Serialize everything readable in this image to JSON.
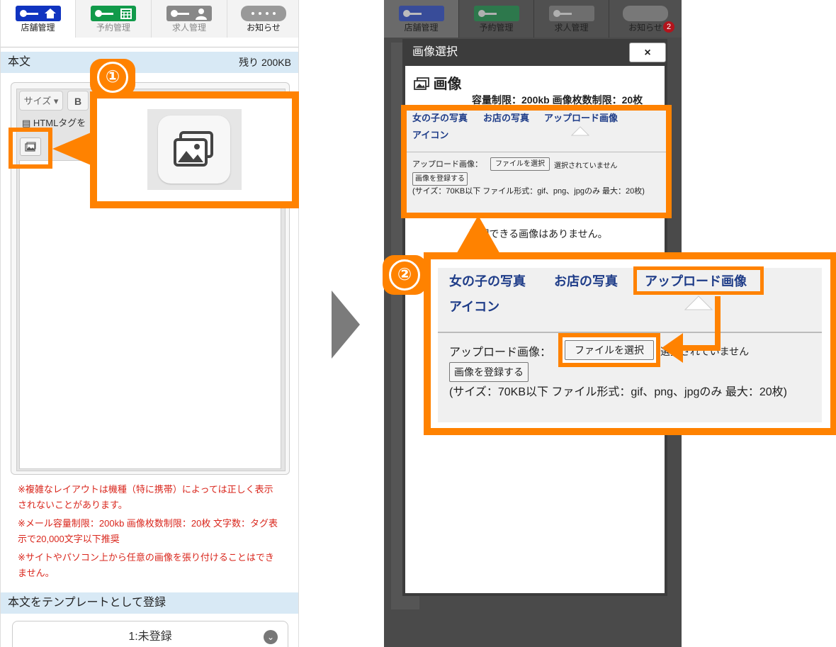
{
  "left": {
    "tabs": [
      {
        "label": "店舗管理",
        "icon": "store-key-icon",
        "color": "#1034c0"
      },
      {
        "label": "予約管理",
        "icon": "calendar-key-icon",
        "color": "#119a4a"
      },
      {
        "label": "求人管理",
        "icon": "person-key-icon",
        "color": "#888888"
      },
      {
        "label": "お知らせ",
        "icon": "speech-bubble-icon",
        "color": "#888888"
      }
    ],
    "body_section": {
      "title": "本文",
      "remaining": "残り 200KB"
    },
    "editor": {
      "size_label": "サイズ",
      "bold_label": "B",
      "html_tag_label": "HTMLタグを"
    },
    "notes": [
      "※複雑なレイアウトは機種（特に携帯）によっては正しく表示されないことがあります。",
      "※メール容量制限：200kb 画像枚数制限：20枚 文字数：タグ表示で20,000文字以下推奨",
      "※サイトやパソコン上から任意の画像を張り付けることはできません。"
    ],
    "template_section": {
      "title": "本文をテンプレートとして登録"
    },
    "template_select": {
      "value": "1:未登録"
    }
  },
  "callout1": {
    "number": "①"
  },
  "right": {
    "tabs": [
      {
        "label": "店舗管理",
        "color": "#1034c0"
      },
      {
        "label": "予約管理",
        "color": "#119a4a"
      },
      {
        "label": "求人管理",
        "color": "#888888"
      },
      {
        "label": "お知らせ",
        "color": "#888888",
        "badge": "2"
      }
    ],
    "modal": {
      "header": "画像選択",
      "close": "×",
      "title": "画像",
      "limit": "容量制限：200kb 画像枚数制限：20枚",
      "tabs": [
        "女の子の写真",
        "お店の写真",
        "アップロード画像",
        "アイコン"
      ],
      "upload_label": "アップロード画像：",
      "file_button": "ファイルを選択",
      "file_status": "選択されていません",
      "register_button": "画像を登録する",
      "note": "(サイズ：70KB以下 ファイル形式：gif、png、jpgのみ 最大：20枚)",
      "empty": "選択できる画像はありません。"
    }
  },
  "callout2": {
    "number": "②"
  },
  "colors": {
    "accent": "#ff8200",
    "link": "#1e3c88",
    "note_red": "#d9261c",
    "section_bg": "#d8e9f5"
  }
}
